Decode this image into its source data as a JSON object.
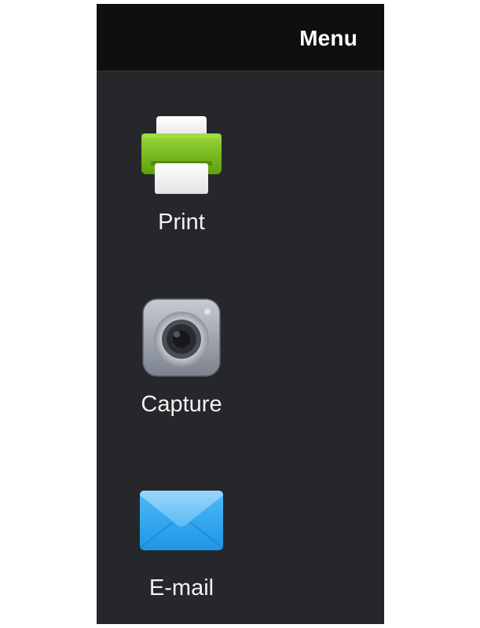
{
  "header": {
    "title": "Menu"
  },
  "menu": {
    "items": [
      {
        "label": "Print",
        "icon": "printer-icon"
      },
      {
        "label": "Capture",
        "icon": "camera-icon"
      },
      {
        "label": "E-mail",
        "icon": "envelope-icon"
      }
    ]
  },
  "colors": {
    "panel_background": "#26272b",
    "header_background": "#0f0f10",
    "printer_green": "#7cc11a",
    "envelope_blue": "#2ea8f2"
  }
}
